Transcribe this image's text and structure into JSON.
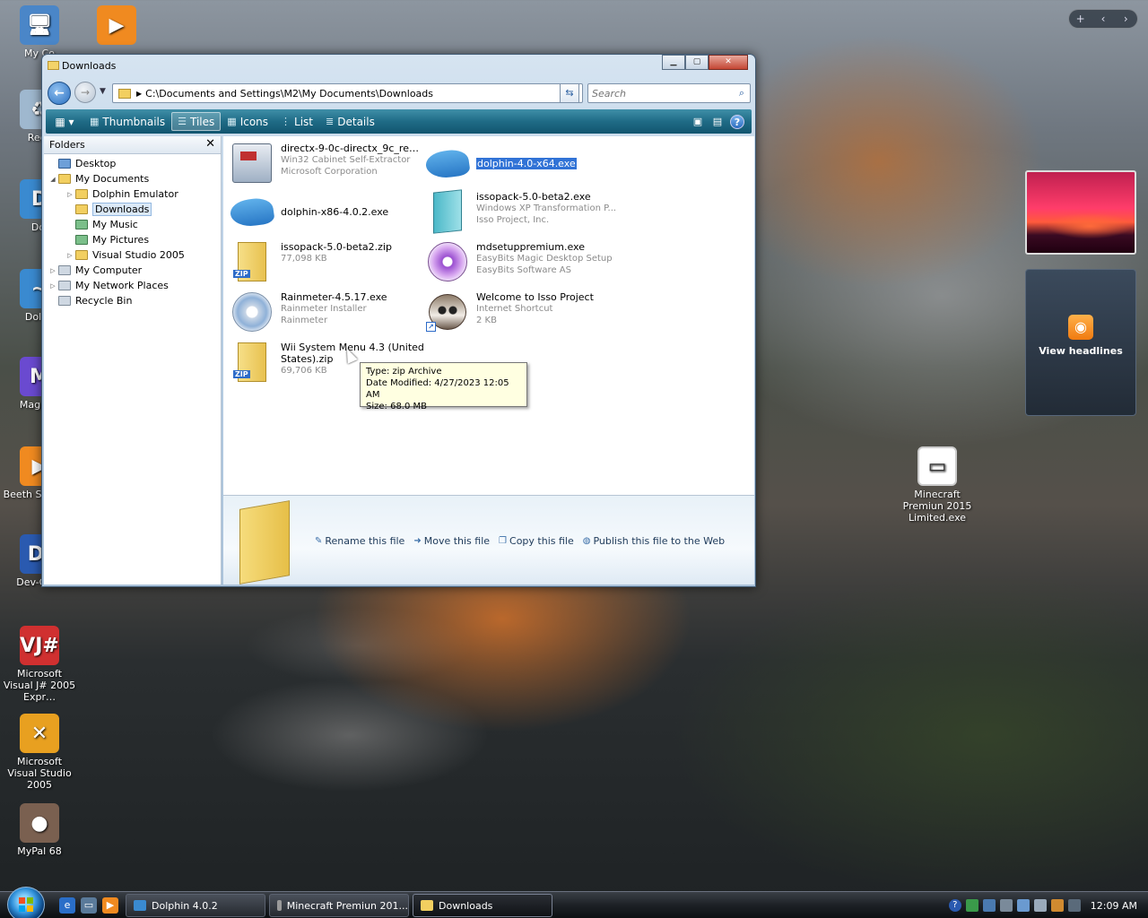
{
  "desktop_icons": [
    {
      "label": "My Co",
      "icon": "computer-icon",
      "color": "#4a86c8"
    },
    {
      "label": "",
      "icon": "media-player-icon",
      "color": "#f08a20"
    },
    {
      "label": "Recy",
      "icon": "recycle-bin-icon",
      "color": "#9fb8cf"
    },
    {
      "label": "Dol",
      "icon": "dolphin-shortcut-icon",
      "color": "#3a8ad0"
    },
    {
      "label": "Dolph",
      "icon": "dolphin-icon",
      "color": "#3a8ad0"
    },
    {
      "label": "Magic D",
      "icon": "magic-desktop-icon",
      "color": "#6a4ad0"
    },
    {
      "label": "Beeth Sympho",
      "icon": "media-player-icon",
      "color": "#f08a20"
    },
    {
      "label": "Dev-C++",
      "icon": "devcpp-icon",
      "color": "#2a5ab0"
    },
    {
      "label": "Microsoft Visual J# 2005 Expr…",
      "icon": "vjsharp-icon",
      "color": "#d03030"
    },
    {
      "label": "Microsoft Visual Studio 2005",
      "icon": "visual-studio-icon",
      "color": "#e8a020"
    },
    {
      "label": "MyPal 68",
      "icon": "raccoon-icon",
      "color": "#7a6050"
    },
    {
      "label": "Minecraft Premiun 2015 Limited.exe",
      "icon": "exe-window-icon",
      "color": "#e8e8e8"
    }
  ],
  "sidebar": {
    "add_label": "+",
    "prev_label": "‹",
    "next_label": "›",
    "feed_label": "View headlines"
  },
  "window": {
    "title": "Downloads",
    "min_label": "▁",
    "max_label": "▢",
    "close_label": "✕"
  },
  "nav": {
    "back_label": "←",
    "fwd_label": "→",
    "path": "C:\\Documents and Settings\\M2\\My Documents\\Downloads",
    "search_placeholder": "Search"
  },
  "toolbar": {
    "views_label": "▦ ▾",
    "items": [
      {
        "label": "Thumbnails",
        "icon": "thumbnails-icon",
        "active": false
      },
      {
        "label": "Tiles",
        "icon": "tiles-icon",
        "active": true
      },
      {
        "label": "Icons",
        "icon": "icons-view-icon",
        "active": false
      },
      {
        "label": "List",
        "icon": "list-view-icon",
        "active": false
      },
      {
        "label": "Details",
        "icon": "details-view-icon",
        "active": false
      }
    ]
  },
  "folders": {
    "header": "Folders",
    "close_label": "✕",
    "items": [
      {
        "label": "Desktop",
        "indent": 0,
        "expander": "",
        "icon": "blue"
      },
      {
        "label": "My Documents",
        "indent": 0,
        "expander": "◢",
        "icon": "folder"
      },
      {
        "label": "Dolphin Emulator",
        "indent": 1,
        "expander": "▷",
        "icon": "folder"
      },
      {
        "label": "Downloads",
        "indent": 1,
        "expander": "",
        "icon": "folder",
        "selected": true
      },
      {
        "label": "My Music",
        "indent": 1,
        "expander": "",
        "icon": "green"
      },
      {
        "label": "My Pictures",
        "indent": 1,
        "expander": "",
        "icon": "green"
      },
      {
        "label": "Visual Studio 2005",
        "indent": 1,
        "expander": "▷",
        "icon": "folder"
      },
      {
        "label": "My Computer",
        "indent": 0,
        "expander": "▷",
        "icon": "gray"
      },
      {
        "label": "My Network Places",
        "indent": 0,
        "expander": "▷",
        "icon": "gray"
      },
      {
        "label": "Recycle Bin",
        "indent": 0,
        "expander": "",
        "icon": "gray"
      }
    ]
  },
  "files": [
    {
      "name": "directx-9-0c-directx_9c_redist...",
      "line2": "Win32 Cabinet Self-Extractor",
      "line3": "Microsoft Corporation",
      "icon": "setup",
      "selected": false
    },
    {
      "name": "dolphin-4.0-x64.exe",
      "line2": "",
      "line3": "",
      "icon": "dolphin",
      "selected": true
    },
    {
      "name": "dolphin-x86-4.0.2.exe",
      "line2": "",
      "line3": "",
      "icon": "dolphin",
      "selected": false
    },
    {
      "name": "issopack-5.0-beta2.exe",
      "line2": "Windows XP Transformation P...",
      "line3": "Isso Project, Inc.",
      "icon": "book",
      "selected": false
    },
    {
      "name": "issopack-5.0-beta2.zip",
      "line2": "77,098 KB",
      "line3": "",
      "icon": "zip",
      "selected": false
    },
    {
      "name": "mdsetuppremium.exe",
      "line2": "EasyBits Magic Desktop Setup",
      "line3": "EasyBits Software AS",
      "icon": "disc",
      "selected": false
    },
    {
      "name": "Rainmeter-4.5.17.exe",
      "line2": "Rainmeter Installer",
      "line3": "Rainmeter",
      "icon": "cd",
      "selected": false
    },
    {
      "name": "Welcome to Isso Project",
      "line2": "Internet Shortcut",
      "line3": "2 KB",
      "icon": "raccoon",
      "selected": false
    },
    {
      "name": "Wii System Menu 4.3 (United States).zip",
      "line2": "69,706 KB",
      "line3": "",
      "icon": "zip",
      "selected": false
    }
  ],
  "tooltip": {
    "type": "Type: zip Archive",
    "modified": "Date Modified: 4/27/2023 12:05 AM",
    "size": "Size: 68.0 MB"
  },
  "details": {
    "tasks": [
      {
        "label": "Rename this file",
        "icon": "rename-icon"
      },
      {
        "label": "Move this file",
        "icon": "move-icon"
      },
      {
        "label": "Copy this file",
        "icon": "copy-icon"
      },
      {
        "label": "Publish this file to the Web",
        "icon": "publish-web-icon"
      }
    ]
  },
  "taskbar": {
    "buttons": [
      {
        "label": "Dolphin 4.0.2",
        "icon_color": "#3a8ad0",
        "active": false
      },
      {
        "label": "Minecraft Premiun 201...",
        "icon_color": "#9a9a9a",
        "active": false
      },
      {
        "label": "Downloads",
        "icon_color": "#f2cf60",
        "active": true
      }
    ],
    "clock": "12:09 AM"
  },
  "colors": {
    "toolbar": "#1f6b86",
    "selection": "#3173d6",
    "tooltip_bg": "#ffffe1"
  }
}
